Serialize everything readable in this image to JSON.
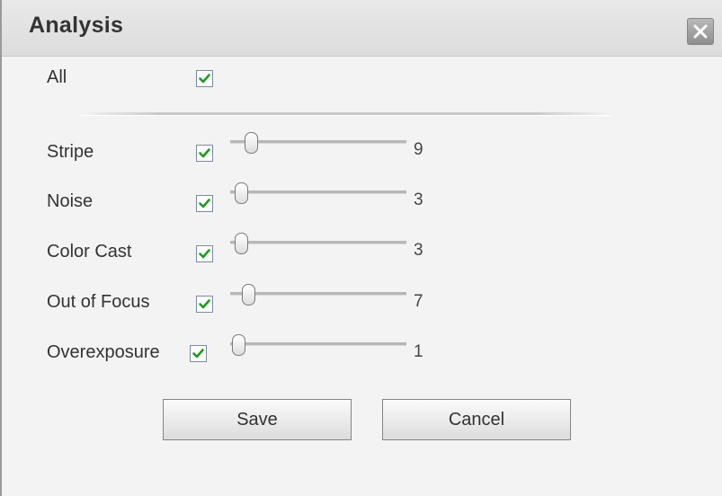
{
  "dialog": {
    "title": "Analysis",
    "close_icon": "close-icon"
  },
  "all": {
    "label": "All",
    "checked": true
  },
  "items": [
    {
      "label": "Stripe",
      "checked": true,
      "value": 9
    },
    {
      "label": "Noise",
      "checked": true,
      "value": 3
    },
    {
      "label": "Color Cast",
      "checked": true,
      "value": 3
    },
    {
      "label": "Out of Focus",
      "checked": true,
      "value": 7
    },
    {
      "label": "Overexposure",
      "checked": true,
      "value": 1
    }
  ],
  "buttons": {
    "save_label": "Save",
    "cancel_label": "Cancel"
  },
  "colors": {
    "checkmark": "#1f9a1f",
    "title_text": "#333333"
  }
}
